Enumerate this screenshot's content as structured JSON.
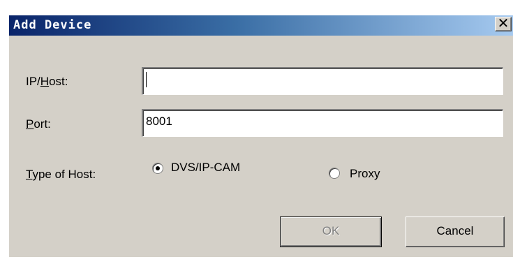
{
  "window": {
    "title": "Add Device",
    "close_glyph": "✕"
  },
  "form": {
    "ip_host": {
      "label_pre": "IP/",
      "label_accel": "H",
      "label_post": "ost:",
      "value": ""
    },
    "port": {
      "label_accel": "P",
      "label_post": "ort:",
      "value": "8001"
    },
    "type_of_host": {
      "label_accel": "T",
      "label_post": "ype of Host:",
      "options": [
        {
          "label": "DVS/IP-CAM",
          "selected": true
        },
        {
          "label": "Proxy",
          "selected": false
        }
      ]
    }
  },
  "buttons": {
    "ok_label": "OK",
    "ok_enabled": false,
    "cancel_label": "Cancel"
  },
  "colors": {
    "titlebar_start": "#0a246a",
    "titlebar_end": "#a6caf0",
    "dialog_bg": "#d4d0c8",
    "disabled_text": "#808080"
  }
}
